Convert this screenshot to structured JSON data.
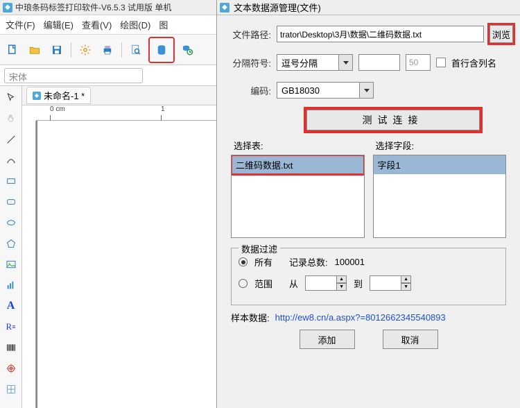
{
  "main": {
    "title": "中琅条码标签打印软件-V6.5.3 试用版 单机",
    "menus": {
      "file": "文件(F)",
      "edit": "编辑(E)",
      "view": "查看(V)",
      "draw": "绘图(D)",
      "imgcut": "图"
    },
    "font_display": "宋体",
    "doc_tab": "未命名-1 *",
    "ruler": {
      "zero": "0 cm",
      "one": "1"
    }
  },
  "dialog": {
    "title": "文本数据源管理(文件)",
    "labels": {
      "path": "文件路径:",
      "delimiter": "分隔符号:",
      "encoding": "编码:",
      "select_table": "选择表:",
      "select_field": "选择字段:",
      "filter_legend": "数据过滤",
      "record_count_lbl": "记录总数:",
      "from": "从",
      "to": "到",
      "sample": "样本数据:"
    },
    "buttons": {
      "browse": "浏览",
      "test": "测试连接",
      "add": "添加",
      "cancel": "取消"
    },
    "values": {
      "path": "trator\\Desktop\\3月\\数据\\二维码数据.txt",
      "delimiter": "逗号分隔",
      "col_box": "",
      "num_box": "50",
      "firstrow_label": "首行含列名",
      "encoding": "GB18030",
      "table_item": "二维码数据.txt",
      "field_item": "字段1",
      "radio_all": "所有",
      "radio_range": "范围",
      "record_count": "100001",
      "sample_link": "http://ew8.cn/a.aspx?=8012662345540893"
    }
  }
}
